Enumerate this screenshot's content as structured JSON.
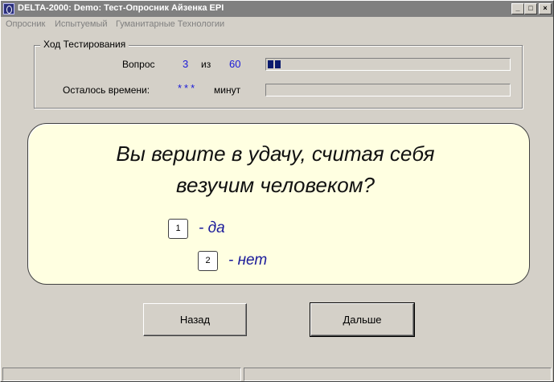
{
  "window": {
    "title": "DELTA-2000: Demo: Тест-Опросник Айзенка EPI",
    "minimize_glyph": "_",
    "maximize_glyph": "□",
    "close_glyph": "×"
  },
  "menu": {
    "items": [
      {
        "label": "Опросник"
      },
      {
        "label": "Испытуемый"
      },
      {
        "label": "Гуманитарные Технологии"
      }
    ]
  },
  "progress_group": {
    "legend": "Ход Тестирования",
    "question_label": "Вопрос",
    "current_question": "3",
    "of_label": "из",
    "total_questions": "60",
    "question_progress_fraction": 0.05,
    "time_label": "Осталось времени:",
    "time_value": "***",
    "time_unit": "минут",
    "time_progress_fraction": 0
  },
  "question": {
    "line1": "Вы верите в удачу, считая себя",
    "line2": "везучим человеком?",
    "answers": [
      {
        "key": "1",
        "text": "- да"
      },
      {
        "key": "2",
        "text": "- нет"
      }
    ]
  },
  "buttons": {
    "back_label": "Назад",
    "next_label": "Дальше"
  },
  "colors": {
    "window_bg": "#d4d0c8",
    "panel_bg": "#ffffe1",
    "accent_blue": "#1a1ad8",
    "progress_fill": "#0a1a6e"
  }
}
